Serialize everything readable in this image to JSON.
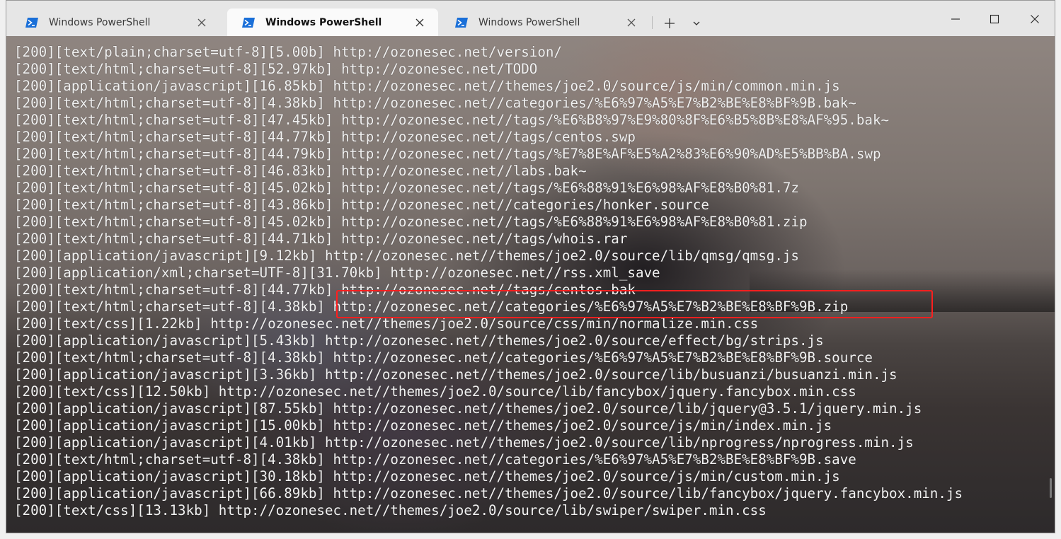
{
  "tabs": [
    {
      "label": "Windows PowerShell",
      "active": false
    },
    {
      "label": "Windows PowerShell",
      "active": true
    },
    {
      "label": "Windows PowerShell",
      "active": false
    }
  ],
  "icons": {
    "tab": "powershell-icon",
    "tab_close": "close-icon",
    "new_tab": "plus-icon",
    "dropdown": "chevron-down-icon",
    "minimize": "minimize-icon",
    "maximize": "maximize-icon",
    "close": "close-icon"
  },
  "colors": {
    "highlight": "#ff1f1f",
    "powershell_icon": "#1a6fd8",
    "terminal_text": "#f2f2f2"
  },
  "terminal": {
    "highlighted_line_index": 15,
    "lines": [
      "[200][text/plain;charset=utf-8][5.00b] http://ozonesec.net/version/",
      "[200][text/html;charset=utf-8][52.97kb] http://ozonesec.net/TODO",
      "[200][application/javascript][16.85kb] http://ozonesec.net//themes/joe2.0/source/js/min/common.min.js",
      "[200][text/html;charset=utf-8][4.38kb] http://ozonesec.net//categories/%E6%97%A5%E7%B2%BE%E8%BF%9B.bak~",
      "[200][text/html;charset=utf-8][47.45kb] http://ozonesec.net//tags/%E6%B8%97%E9%80%8F%E6%B5%8B%E8%AF%95.bak~",
      "[200][text/html;charset=utf-8][44.77kb] http://ozonesec.net//tags/centos.swp",
      "[200][text/html;charset=utf-8][44.79kb] http://ozonesec.net//tags/%E7%8E%AF%E5%A2%83%E6%90%AD%E5%BB%BA.swp",
      "[200][text/html;charset=utf-8][46.83kb] http://ozonesec.net//labs.bak~",
      "[200][text/html;charset=utf-8][45.02kb] http://ozonesec.net//tags/%E6%88%91%E6%98%AF%E8%B0%81.7z",
      "[200][text/html;charset=utf-8][43.86kb] http://ozonesec.net//categories/honker.source",
      "[200][text/html;charset=utf-8][45.02kb] http://ozonesec.net//tags/%E6%88%91%E6%98%AF%E8%B0%81.zip",
      "[200][text/html;charset=utf-8][44.71kb] http://ozonesec.net//tags/whois.rar",
      "[200][application/javascript][9.12kb] http://ozonesec.net//themes/joe2.0/source/lib/qmsg/qmsg.js",
      "[200][application/xml;charset=UTF-8][31.70kb] http://ozonesec.net//rss.xml_save",
      "[200][text/html;charset=utf-8][44.77kb] http://ozonesec.net//tags/centos.bak",
      "[200][text/html;charset=utf-8][4.38kb] http://ozonesec.net//categories/%E6%97%A5%E7%B2%BE%E8%BF%9B.zip",
      "[200][text/css][1.22kb] http://ozonesec.net//themes/joe2.0/source/css/min/normalize.min.css",
      "[200][application/javascript][5.43kb] http://ozonesec.net//themes/joe2.0/source/effect/bg/strips.js",
      "[200][text/html;charset=utf-8][4.38kb] http://ozonesec.net//categories/%E6%97%A5%E7%B2%BE%E8%BF%9B.source",
      "[200][application/javascript][3.36kb] http://ozonesec.net//themes/joe2.0/source/lib/busuanzi/busuanzi.min.js",
      "[200][text/css][12.50kb] http://ozonesec.net//themes/joe2.0/source/lib/fancybox/jquery.fancybox.min.css",
      "[200][application/javascript][87.55kb] http://ozonesec.net//themes/joe2.0/source/lib/jquery@3.5.1/jquery.min.js",
      "[200][application/javascript][15.00kb] http://ozonesec.net//themes/joe2.0/source/js/min/index.min.js",
      "[200][application/javascript][4.01kb] http://ozonesec.net//themes/joe2.0/source/lib/nprogress/nprogress.min.js",
      "[200][text/html;charset=utf-8][4.38kb] http://ozonesec.net//categories/%E6%97%A5%E7%B2%BE%E8%BF%9B.save",
      "[200][application/javascript][30.18kb] http://ozonesec.net//themes/joe2.0/source/js/min/custom.min.js",
      "[200][application/javascript][66.89kb] http://ozonesec.net//themes/joe2.0/source/lib/fancybox/jquery.fancybox.min.js",
      "[200][text/css][13.13kb] http://ozonesec.net//themes/joe2.0/source/lib/swiper/swiper.min.css"
    ]
  }
}
